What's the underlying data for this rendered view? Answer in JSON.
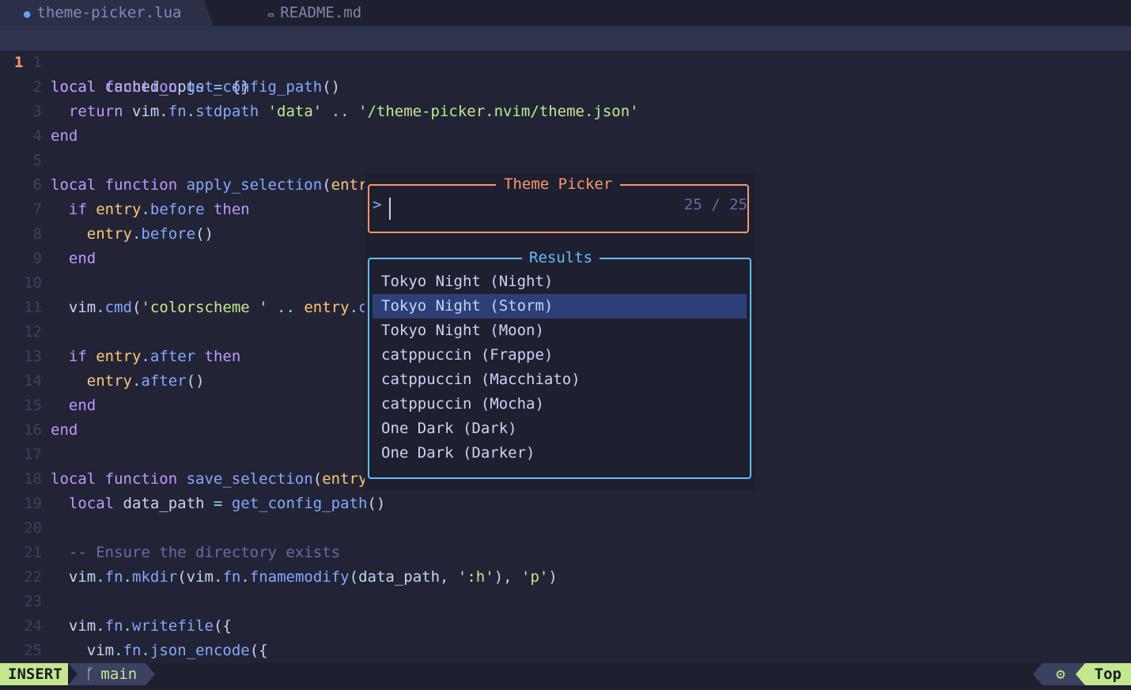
{
  "tabs": [
    {
      "icon": "lua-icon",
      "label": "theme-picker.lua",
      "active": true
    },
    {
      "icon": "markdown-icon",
      "label": "README.md",
      "active": false
    }
  ],
  "editor": {
    "current_line": {
      "number": "1",
      "text": "local cached_opts = {}"
    },
    "lines": [
      {
        "n": "1",
        "segs": []
      },
      {
        "n": "2",
        "segs": [
          [
            "kw",
            "local "
          ],
          [
            "kw",
            "function "
          ],
          [
            "fn",
            "get_config_path"
          ],
          [
            "brk",
            "()"
          ]
        ]
      },
      {
        "n": "3",
        "segs": [
          [
            "var",
            "  "
          ],
          [
            "kw",
            "return "
          ],
          [
            "var",
            "vim"
          ],
          [
            "dot",
            "."
          ],
          [
            "fn",
            "fn"
          ],
          [
            "dot",
            "."
          ],
          [
            "fn",
            "stdpath "
          ],
          [
            "str",
            "'data'"
          ],
          [
            "op",
            " .. "
          ],
          [
            "str",
            "'/theme-picker.nvim/theme.json'"
          ]
        ]
      },
      {
        "n": "4",
        "segs": [
          [
            "kw",
            "end"
          ]
        ]
      },
      {
        "n": "5",
        "segs": []
      },
      {
        "n": "6",
        "segs": [
          [
            "kw",
            "local "
          ],
          [
            "kw",
            "function "
          ],
          [
            "fn",
            "apply_selection"
          ],
          [
            "brk",
            "("
          ],
          [
            "par",
            "entry"
          ]
        ]
      },
      {
        "n": "7",
        "segs": [
          [
            "var",
            "  "
          ],
          [
            "kw",
            "if "
          ],
          [
            "par",
            "entry"
          ],
          [
            "dot",
            "."
          ],
          [
            "fn",
            "before "
          ],
          [
            "kw",
            "then"
          ]
        ]
      },
      {
        "n": "8",
        "segs": [
          [
            "var",
            "    "
          ],
          [
            "par",
            "entry"
          ],
          [
            "dot",
            "."
          ],
          [
            "fn",
            "before"
          ],
          [
            "brk",
            "()"
          ]
        ]
      },
      {
        "n": "9",
        "segs": [
          [
            "var",
            "  "
          ],
          [
            "kw",
            "end"
          ]
        ]
      },
      {
        "n": "10",
        "segs": []
      },
      {
        "n": "11",
        "segs": [
          [
            "var",
            "  vim"
          ],
          [
            "dot",
            "."
          ],
          [
            "fn",
            "cmd"
          ],
          [
            "brk",
            "("
          ],
          [
            "str",
            "'colorscheme '"
          ],
          [
            "op",
            " .. "
          ],
          [
            "par",
            "entry"
          ],
          [
            "dot",
            "."
          ],
          [
            "fn",
            "co"
          ]
        ]
      },
      {
        "n": "12",
        "segs": []
      },
      {
        "n": "13",
        "segs": [
          [
            "var",
            "  "
          ],
          [
            "kw",
            "if "
          ],
          [
            "par",
            "entry"
          ],
          [
            "dot",
            "."
          ],
          [
            "fn",
            "after "
          ],
          [
            "kw",
            "then"
          ]
        ]
      },
      {
        "n": "14",
        "segs": [
          [
            "var",
            "    "
          ],
          [
            "par",
            "entry"
          ],
          [
            "dot",
            "."
          ],
          [
            "fn",
            "after"
          ],
          [
            "brk",
            "()"
          ]
        ]
      },
      {
        "n": "15",
        "segs": [
          [
            "var",
            "  "
          ],
          [
            "kw",
            "end"
          ]
        ]
      },
      {
        "n": "16",
        "segs": [
          [
            "kw",
            "end"
          ]
        ]
      },
      {
        "n": "17",
        "segs": []
      },
      {
        "n": "18",
        "segs": [
          [
            "kw",
            "local "
          ],
          [
            "kw",
            "function "
          ],
          [
            "fn",
            "save_selection"
          ],
          [
            "brk",
            "("
          ],
          [
            "par",
            "entry"
          ],
          [
            "brk",
            ")"
          ]
        ]
      },
      {
        "n": "19",
        "segs": [
          [
            "var",
            "  "
          ],
          [
            "kw",
            "local "
          ],
          [
            "var",
            "data_path "
          ],
          [
            "op",
            "= "
          ],
          [
            "fn",
            "get_config_path"
          ],
          [
            "brk",
            "()"
          ]
        ]
      },
      {
        "n": "20",
        "segs": []
      },
      {
        "n": "21",
        "segs": [
          [
            "com",
            "  -- Ensure the directory exists"
          ]
        ]
      },
      {
        "n": "22",
        "segs": [
          [
            "var",
            "  vim"
          ],
          [
            "dot",
            "."
          ],
          [
            "fn",
            "fn"
          ],
          [
            "dot",
            "."
          ],
          [
            "fn",
            "mkdir"
          ],
          [
            "brk",
            "("
          ],
          [
            "var",
            "vim"
          ],
          [
            "dot",
            "."
          ],
          [
            "fn",
            "fn"
          ],
          [
            "dot",
            "."
          ],
          [
            "fn",
            "fnamemodify"
          ],
          [
            "brk",
            "("
          ],
          [
            "var",
            "data_path"
          ],
          [
            "brk",
            ", "
          ],
          [
            "str",
            "':h'"
          ],
          [
            "brk",
            "), "
          ],
          [
            "str",
            "'p'"
          ],
          [
            "brk",
            ")"
          ]
        ]
      },
      {
        "n": "23",
        "segs": []
      },
      {
        "n": "24",
        "segs": [
          [
            "var",
            "  vim"
          ],
          [
            "dot",
            "."
          ],
          [
            "fn",
            "fn"
          ],
          [
            "dot",
            "."
          ],
          [
            "fn",
            "writefile"
          ],
          [
            "brk",
            "({"
          ]
        ]
      },
      {
        "n": "25",
        "segs": [
          [
            "var",
            "    vim"
          ],
          [
            "dot",
            "."
          ],
          [
            "fn",
            "fn"
          ],
          [
            "dot",
            "."
          ],
          [
            "fn",
            "json_encode"
          ],
          [
            "brk",
            "({"
          ]
        ]
      }
    ]
  },
  "picker": {
    "title": "Theme Picker",
    "prompt_symbol": ">",
    "query": "",
    "counter": "25 / 25",
    "results_title": "Results",
    "selected_index": 1,
    "results": [
      "Tokyo Night (Night)",
      "Tokyo Night (Storm)",
      "Tokyo Night (Moon)",
      "catppuccin (Frappe)",
      "catppuccin (Macchiato)",
      "catppuccin (Mocha)",
      "One Dark (Dark)",
      "One Dark (Darker)"
    ]
  },
  "statusline": {
    "mode": "INSERT",
    "branch_icon": "git-branch-icon",
    "branch": "main",
    "lsp_icon": "lsp-icon",
    "position": "Top"
  },
  "colors": {
    "background": "#222436",
    "accent_orange": "#ff966c",
    "accent_blue": "#65bcff",
    "mode_green": "#c3e88d",
    "selection": "#2d3f76"
  }
}
